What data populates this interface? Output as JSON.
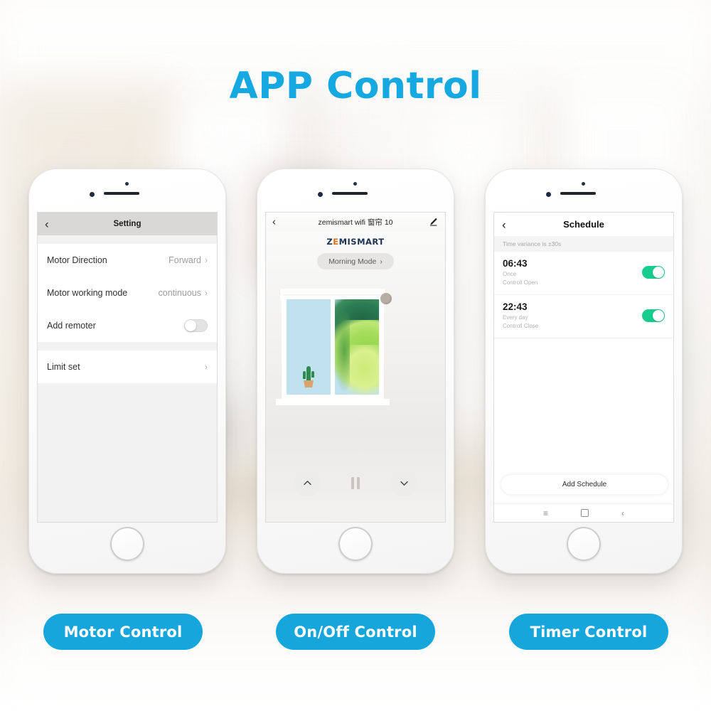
{
  "page": {
    "title": "APP Control",
    "accent_color": "#16a9e1",
    "caption_color": "#17a6dc"
  },
  "phone1": {
    "screen_name": "setting-screen",
    "header": {
      "back_icon": "chevron-left-icon",
      "title": "Setting"
    },
    "rows": [
      {
        "label": "Motor Direction",
        "value": "Forward",
        "control": "chevron"
      },
      {
        "label": "Motor working mode",
        "value": "continuous",
        "control": "chevron"
      },
      {
        "label": "Add remoter",
        "value": "",
        "control": "toggle-off"
      }
    ],
    "rows2": [
      {
        "label": "Limit set",
        "value": "",
        "control": "chevron"
      }
    ],
    "chevron_glyph": "›"
  },
  "phone2": {
    "screen_name": "device-control-screen",
    "header": {
      "back_icon": "chevron-left-icon",
      "title": "zemismart wifi 窗帘 10",
      "edit_icon": "pencil-edit-icon"
    },
    "brand_prefix": "Z",
    "brand_accent": "E",
    "brand_suffix": "MISMART",
    "mode_pill": {
      "label": "Morning Mode",
      "chevron": "›"
    },
    "artwork": {
      "name": "window-curtain-illustration",
      "sky_color": "#bfe2ee",
      "foliage_dark": "#2a7a52",
      "foliage_light": "#bfe877",
      "roller_color": "#b6ada3"
    },
    "controls": [
      {
        "name": "open-up-button",
        "glyph": "︿"
      },
      {
        "name": "pause-button",
        "glyph": ""
      },
      {
        "name": "close-down-button",
        "glyph": "﹀"
      }
    ]
  },
  "phone3": {
    "screen_name": "schedule-screen",
    "header": {
      "back_icon": "chevron-left-icon",
      "title": "Schedule"
    },
    "variance_note": "Time variance is ±30s",
    "schedules": [
      {
        "time": "06:43",
        "repeat": "Once",
        "action": "Controll Open",
        "enabled": "on"
      },
      {
        "time": "22:43",
        "repeat": "Every day",
        "action": "Controll Close",
        "enabled": "on"
      }
    ],
    "add_button": "Add Schedule",
    "toggle_on_color": "#16cc8e",
    "nav": [
      {
        "name": "android-menu-icon",
        "glyph": "≡"
      },
      {
        "name": "android-home-icon",
        "glyph": ""
      },
      {
        "name": "android-back-icon",
        "glyph": "‹"
      }
    ]
  },
  "captions": [
    {
      "label": "Motor Control"
    },
    {
      "label": "On/Off Control"
    },
    {
      "label": "Timer Control"
    }
  ]
}
